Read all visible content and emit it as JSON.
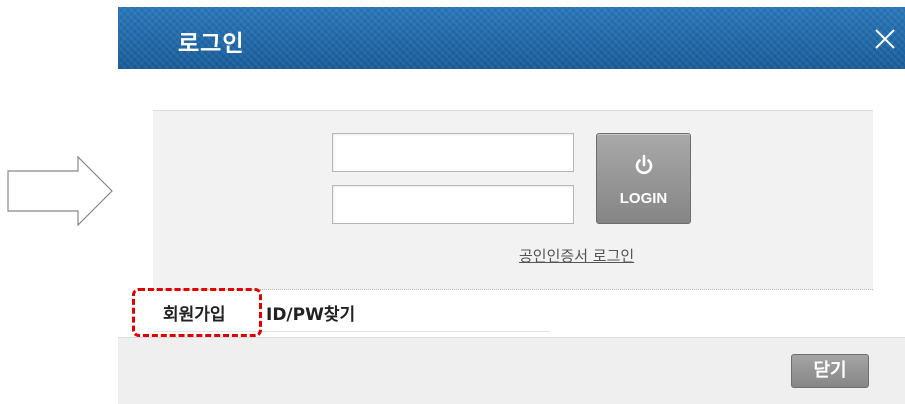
{
  "dialog": {
    "title": "로그인",
    "close_icon": "close-icon"
  },
  "login": {
    "id_value": "",
    "pw_value": "",
    "button_label": "LOGIN",
    "button_icon": "power-icon",
    "cert_link": "공인인증서 로그인"
  },
  "links": {
    "join": "회원가입",
    "find": "ID/PW찾기"
  },
  "footer": {
    "close_label": "닫기"
  },
  "colors": {
    "titlebar": "#1f6aaa",
    "button": "#969696",
    "highlight": "#e00000"
  }
}
